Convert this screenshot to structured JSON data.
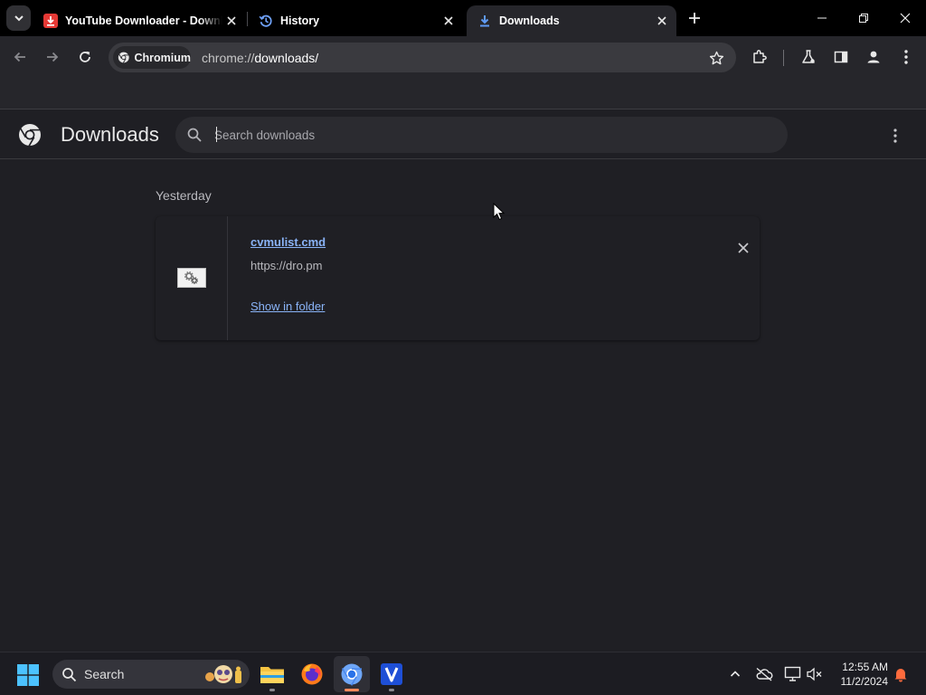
{
  "tabs": [
    {
      "title": "YouTube Downloader - Download Video",
      "icon": "youtube-downloader-icon",
      "active": false
    },
    {
      "title": "History",
      "icon": "history-icon",
      "active": false
    },
    {
      "title": "Downloads",
      "icon": "download-icon",
      "active": true
    }
  ],
  "toolbar": {
    "site_chip": "Chromium",
    "url_scheme": "chrome://",
    "url_host": "downloads",
    "url_path": "/"
  },
  "downloads_page": {
    "title": "Downloads",
    "search_placeholder": "Search downloads",
    "search_value": "",
    "groups": [
      {
        "date": "Yesterday",
        "items": [
          {
            "file_name": "cvmulist.cmd",
            "source_url": "https://dro.pm",
            "action_label": "Show in folder"
          }
        ]
      }
    ]
  },
  "taskbar": {
    "search_label": "Search",
    "apps": [
      "file-explorer",
      "firefox",
      "chromium",
      "v-app"
    ],
    "time": "12:55 AM",
    "date": "11/2/2024"
  },
  "colors": {
    "accent_link": "#8ab4f8",
    "page_bg": "#1f1f24",
    "toolbar_bg": "#26262b",
    "tabstrip_bg": "#000000"
  }
}
